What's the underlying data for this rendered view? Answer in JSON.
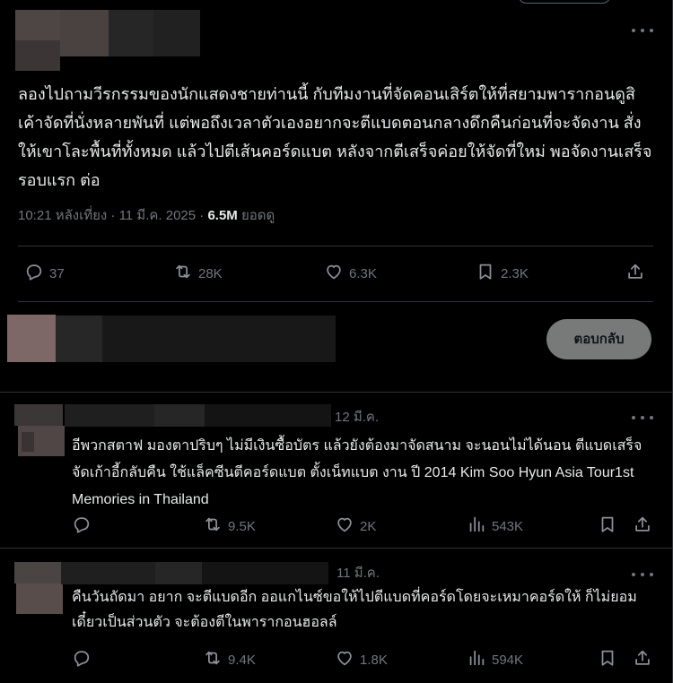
{
  "main_post": {
    "text": "ลองไปถามวีรกรรมของนักแสดงชายท่านนี้ กับทีมงานที่จัดคอนเสิร์ตให้ที่สยามพารากอนดูสิ เค้าจัดที่นั่งหลายพันที่ แต่พอถึงเวลาตัวเองอยากจะตีแบดตอนกลางดึกคืนก่อนที่จะจัดงาน สั่งให้เขาโละพื้นที่ทั้งหมด แล้วไปตีเส้นคอร์ดแบต หลังจากตีเสร็จค่อยให้จัดที่ใหม่ พอจัดงานเสร็จรอบแรก ต่อ",
    "time": "10:21 หลังเที่ยง · 11 มี.ค. 2025 · ",
    "views": "6.5M",
    "views_label": " ยอดดู",
    "actions": {
      "replies": "37",
      "reposts": "28K",
      "likes": "6.3K",
      "bookmarks": "2.3K"
    }
  },
  "compose": {
    "reply_button": "ตอบกลับ"
  },
  "replies": [
    {
      "date": "12 มี.ค.",
      "text": "อีพวกสตาฟ มองตาปริบๆ ไม่มีเงินซื้อบัตร แล้วยังต้องมาจัดสนาม จะนอนไม่ได้นอน ตีแบดเสร็จ จัดเก้าอี้กลับคืน ใช้แล็คซีนตีคอร์ดแบต ตั้งเน็ทแบต งาน ปี 2014 Kim Soo Hyun Asia Tour1st Memories in Thailand",
      "reposts": "9.5K",
      "likes": "2K",
      "views": "543K"
    },
    {
      "date": "11 มี.ค.",
      "text": "คืนวันถัดมา อยาก จะตีแบดอีก ออแกไนซ์ขอให้ไปตีแบดที่คอร์ดโดยจะเหมาคอร์ดให้ ก็ไม่ยอม เดี๋ยวเป็นส่วนตัว จะต้องตีในพารากอนฮอลล์",
      "reposts": "9.4K",
      "likes": "1.8K",
      "views": "594K"
    }
  ],
  "colors": {
    "background": "#000000",
    "text": "#e7e9ea",
    "muted": "#71767b",
    "divider": "#2f3336",
    "reply_button_bg": "#787a7a"
  }
}
